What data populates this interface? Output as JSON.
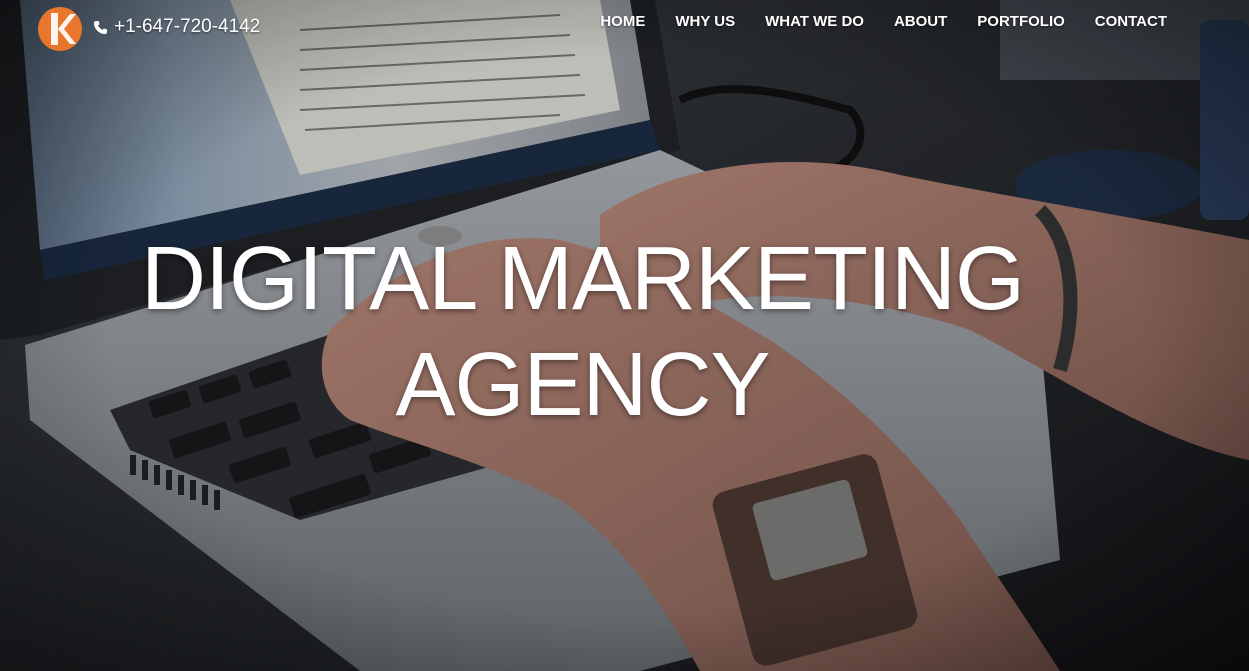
{
  "header": {
    "logo_icon": "k-logo-icon",
    "phone": {
      "icon": "phone-icon",
      "number": "+1-647-720-4142"
    }
  },
  "nav": {
    "items": [
      {
        "label": "HOME"
      },
      {
        "label": "WHY US"
      },
      {
        "label": "WHAT WE DO"
      },
      {
        "label": "ABOUT"
      },
      {
        "label": "PORTFOLIO"
      },
      {
        "label": "CONTACT"
      }
    ]
  },
  "hero": {
    "headline_line1": "DIGITAL MARKETING",
    "headline_line2": "AGENCY"
  },
  "colors": {
    "brand_orange": "#e8762c",
    "text": "#ffffff"
  }
}
